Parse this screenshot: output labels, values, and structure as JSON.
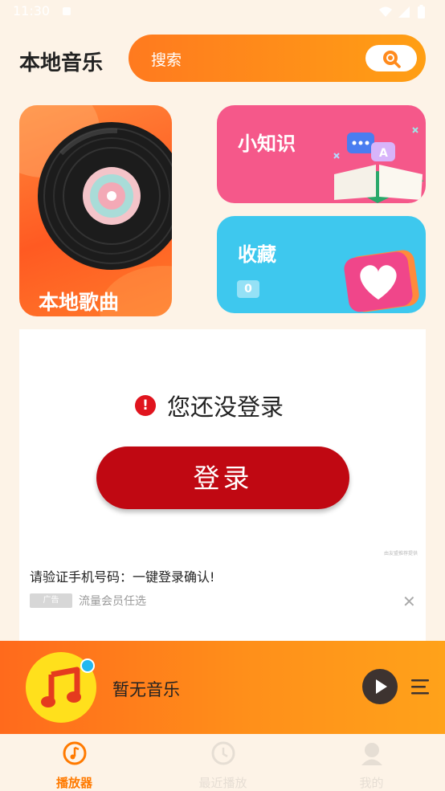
{
  "status_bar": {
    "time": "11:30"
  },
  "header": {
    "title": "本地音乐",
    "search_placeholder": "搜索"
  },
  "cards": {
    "local_songs": {
      "label": "本地歌曲"
    },
    "knowledge": {
      "label": "小知识"
    },
    "favorites": {
      "label": "收藏",
      "count": "0"
    }
  },
  "login_panel": {
    "notice": "您还没登录",
    "login_button": "登录",
    "ad_source": "由友盟推荐提供",
    "ad_title": "请验证手机号码：一键登录确认!",
    "ad_tag": "广告",
    "ad_subtitle": "流量会员任选",
    "ad_close": "✕"
  },
  "player": {
    "title": "暂无音乐"
  },
  "tabs": [
    {
      "label": "播放器",
      "active": true,
      "icon": "music-note-icon"
    },
    {
      "label": "最近播放",
      "active": false,
      "icon": "recent-play-icon"
    },
    {
      "label": "我的",
      "active": false,
      "icon": "user-icon"
    }
  ],
  "colors": {
    "accent": "#ff7a1f",
    "tab_active": "#ff7a00",
    "tab_inactive": "#e6ded4",
    "login_button": "#c00812",
    "knowledge_card": "#f5588a",
    "favorites_card": "#3ec8ee"
  }
}
